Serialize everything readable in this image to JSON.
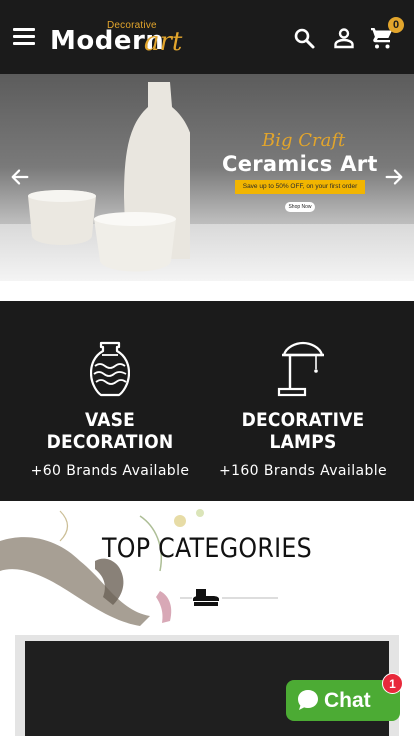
{
  "header": {
    "logo_small": "Decorative",
    "logo_main": "Modern",
    "logo_art": "art",
    "cart_count": "0",
    "icons": [
      "menu-icon",
      "search-icon",
      "user-icon",
      "cart-icon"
    ]
  },
  "banner": {
    "script": "Big Craft",
    "title": "Ceramics Art",
    "offer": "Save up to 50% OFF, on your first order",
    "button": "Shop Now",
    "icons": [
      "arrow-left-icon",
      "arrow-right-icon"
    ]
  },
  "features": [
    {
      "title": "VASE DECORATION",
      "subtitle": "+60 Brands Available",
      "icon": "vase-icon"
    },
    {
      "title": "DECORATIVE LAMPS",
      "subtitle": "+160 Brands Available",
      "icon": "lamp-icon"
    }
  ],
  "categories": {
    "title": "TOP CATEGORIES"
  },
  "chat": {
    "label": "Chat",
    "badge": "1"
  },
  "colors": {
    "header_bg": "#1b1b1b",
    "accent": "#e2a52c",
    "chat_green": "#4cab34",
    "badge_red": "#e8293b"
  }
}
